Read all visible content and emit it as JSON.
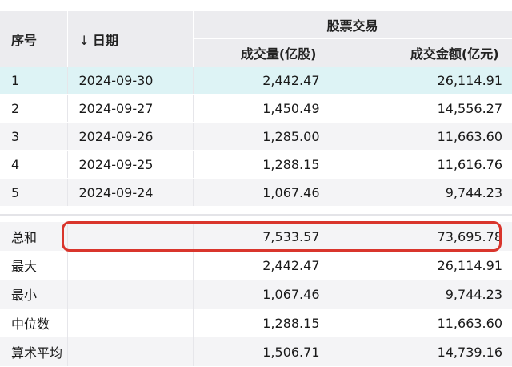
{
  "header": {
    "index": "序号",
    "sort_arrow": "↓",
    "date": "日期",
    "group": "股票交易",
    "volume": "成交量(亿股)",
    "amount": "成交金额(亿元)"
  },
  "rows": [
    {
      "index": "1",
      "date": "2024-09-30",
      "volume": "2,442.47",
      "amount": "26,114.91"
    },
    {
      "index": "2",
      "date": "2024-09-27",
      "volume": "1,450.49",
      "amount": "14,556.27"
    },
    {
      "index": "3",
      "date": "2024-09-26",
      "volume": "1,285.00",
      "amount": "11,663.60"
    },
    {
      "index": "4",
      "date": "2024-09-25",
      "volume": "1,288.15",
      "amount": "11,616.76"
    },
    {
      "index": "5",
      "date": "2024-09-24",
      "volume": "1,067.46",
      "amount": "9,744.23"
    }
  ],
  "stats": [
    {
      "label": "总和",
      "volume": "7,533.57",
      "amount": "73,695.78"
    },
    {
      "label": "最大",
      "volume": "2,442.47",
      "amount": "26,114.91"
    },
    {
      "label": "最小",
      "volume": "1,067.46",
      "amount": "9,744.23"
    },
    {
      "label": "中位数",
      "volume": "1,288.15",
      "amount": "11,663.60"
    },
    {
      "label": "算术平均",
      "volume": "1,506.71",
      "amount": "14,739.16"
    }
  ],
  "colors": {
    "header_bg": "#ececef",
    "highlight_row": "#ddf3f5",
    "annotation_red": "#d9352c"
  }
}
